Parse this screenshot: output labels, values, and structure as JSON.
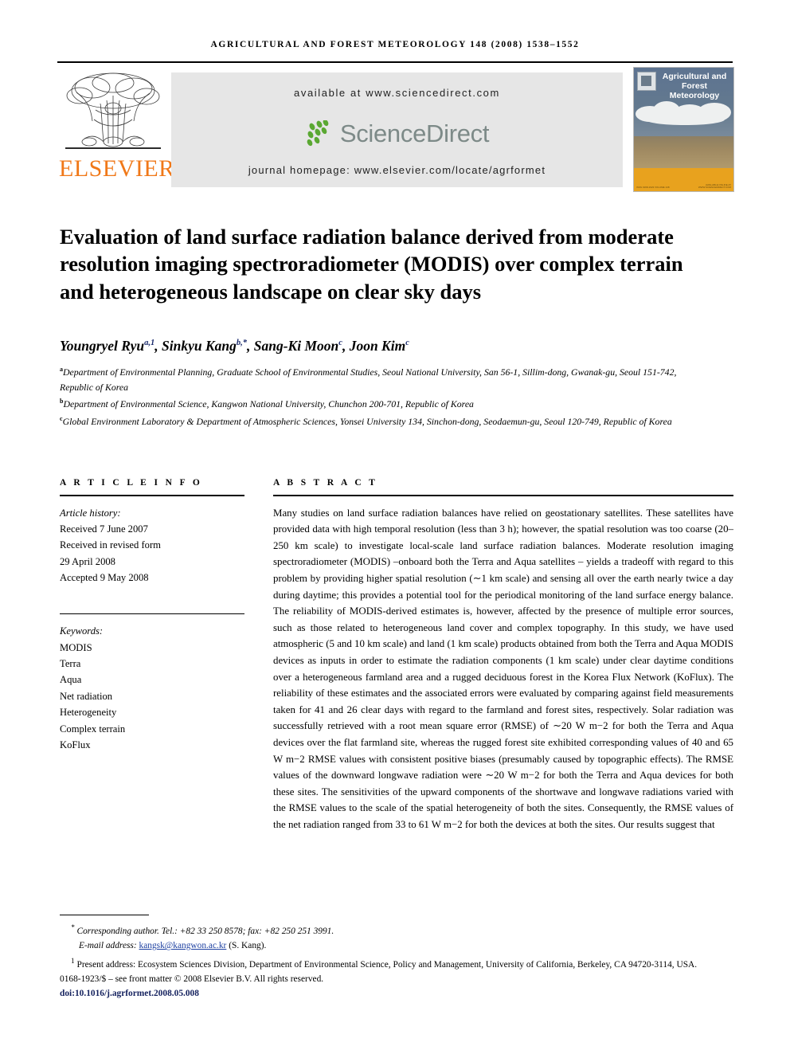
{
  "running_head": "AGRICULTURAL AND FOREST METEOROLOGY 148 (2008) 1538–1552",
  "header": {
    "publisher_name": "ELSEVIER",
    "available_at": "available at www.sciencedirect.com",
    "sciencedirect_word": "ScienceDirect",
    "journal_homepage": "journal homepage: www.elsevier.com/locate/agrformet",
    "cover_title": "Agricultural and Forest Meteorology",
    "cover_fineprint_left": "ISSN 0168-1923 VOLUME 148",
    "cover_fineprint_right": "AVAILABLE ONLINE AT WWW.SCIENCEDIRECT.COM"
  },
  "title": "Evaluation of land surface radiation balance derived from moderate resolution imaging spectroradiometer (MODIS) over complex terrain and heterogeneous landscape on clear sky days",
  "authors": [
    {
      "name": "Youngryel Ryu",
      "marks": "a,1"
    },
    {
      "name": "Sinkyu Kang",
      "marks": "b,*"
    },
    {
      "name": "Sang-Ki Moon",
      "marks": "c"
    },
    {
      "name": "Joon Kim",
      "marks": "c"
    }
  ],
  "affiliations": [
    {
      "mark": "a",
      "text": "Department of Environmental Planning, Graduate School of Environmental Studies, Seoul National University, San 56-1, Sillim-dong, Gwanak-gu, Seoul 151-742, Republic of Korea"
    },
    {
      "mark": "b",
      "text": "Department of Environmental Science, Kangwon National University, Chunchon 200-701, Republic of Korea"
    },
    {
      "mark": "c",
      "text": "Global Environment Laboratory & Department of Atmospheric Sciences, Yonsei University 134, Sinchon-dong, Seodaemun-gu, Seoul 120-749, Republic of Korea"
    }
  ],
  "article_info": {
    "heading": "A R T I C L E   I N F O",
    "history_label": "Article history:",
    "history": [
      "Received 7 June 2007",
      "Received in revised form",
      "29 April 2008",
      "Accepted 9 May 2008"
    ],
    "keywords_label": "Keywords:",
    "keywords": [
      "MODIS",
      "Terra",
      "Aqua",
      "Net radiation",
      "Heterogeneity",
      "Complex terrain",
      "KoFlux"
    ]
  },
  "abstract": {
    "heading": "A B S T R A C T",
    "text": "Many studies on land surface radiation balances have relied on geostationary satellites. These satellites have provided data with high temporal resolution (less than 3 h); however, the spatial resolution was too coarse (20–250 km scale) to investigate local-scale land surface radiation balances. Moderate resolution imaging spectroradiometer (MODIS) –onboard both the Terra and Aqua satellites – yields a tradeoff with regard to this problem by providing higher spatial resolution (∼1 km scale) and sensing all over the earth nearly twice a day during daytime; this provides a potential tool for the periodical monitoring of the land surface energy balance. The reliability of MODIS-derived estimates is, however, affected by the presence of multiple error sources, such as those related to heterogeneous land cover and complex topography. In this study, we have used atmospheric (5 and 10 km scale) and land (1 km scale) products obtained from both the Terra and Aqua MODIS devices as inputs in order to estimate the radiation components (1 km scale) under clear daytime conditions over a heterogeneous farmland area and a rugged deciduous forest in the Korea Flux Network (KoFlux). The reliability of these estimates and the associated errors were evaluated by comparing against field measurements taken for 41 and 26 clear days with regard to the farmland and forest sites, respectively. Solar radiation was successfully retrieved with a root mean square error (RMSE) of ∼20 W m−2 for both the Terra and Aqua devices over the flat farmland site, whereas the rugged forest site exhibited corresponding values of 40 and 65 W m−2 RMSE values with consistent positive biases (presumably caused by topographic effects). The RMSE values of the downward longwave radiation were ∼20 W m−2 for both the Terra and Aqua devices for both these sites. The sensitivities of the upward components of the shortwave and longwave radiations varied with the RMSE values to the scale of the spatial heterogeneity of both the sites. Consequently, the RMSE values of the net radiation ranged from 33 to 61 W m−2 for both the devices at both the sites. Our results suggest that"
  },
  "footnotes": {
    "corresponding": "Corresponding author. Tel.: +82 33 250 8578; fax: +82 250 251 3991.",
    "email_label": "E-mail address:",
    "email": "kangsk@kangwon.ac.kr",
    "email_suffix": "(S. Kang).",
    "present_address": "Present address: Ecosystem Sciences Division, Department of Environmental Science, Policy and Management, University of California, Berkeley, CA 94720-3114, USA.",
    "copyright": "0168-1923/$ – see front matter © 2008 Elsevier B.V. All rights reserved.",
    "doi": "doi:10.1016/j.agrformet.2008.05.008"
  },
  "colors": {
    "elsevier_orange": "#F07818",
    "sciencedirect_gray": "#7d8a88",
    "sciencedirect_green": "#5aa832",
    "link_blue": "#1c3fa0",
    "doi_blue": "#14215e",
    "band_gray": "#e6e6e6"
  }
}
